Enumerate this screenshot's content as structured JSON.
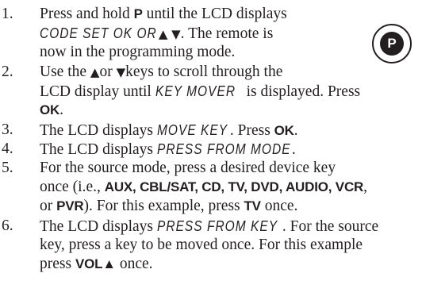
{
  "steps": [
    {
      "num": "1.",
      "l1": [
        "Press and hold ",
        "P",
        " until the LCD displays"
      ],
      "l2": [
        "CODE SET OK OR",
        "▲ ▼",
        ". The remote is"
      ],
      "l3": "now in the programming mode."
    },
    {
      "num": "2.",
      "l1": [
        "Use the ",
        "▲",
        "or ",
        "▼",
        "keys to scroll through the"
      ],
      "l2": [
        "LCD display until ",
        "KEY MOVER",
        " is displayed. Press"
      ],
      "l3": "OK",
      "l3_end": "."
    },
    {
      "num": "3.",
      "l1": [
        " The LCD displays ",
        "MOVE KEY",
        ". Press ",
        "OK",
        "."
      ]
    },
    {
      "num": "4.",
      "l1": [
        "The LCD displays ",
        "PRESS FROM MODE",
        "."
      ]
    },
    {
      "num": "5.",
      "l1": "For the source mode, press a desired device key",
      "l2": [
        "once (i.e., ",
        "AUX, CBL/SAT, CD, TV, DVD, AUDIO, VCR",
        ","
      ],
      "l3": [
        "or ",
        "PVR",
        "). For this example, press ",
        "TV",
        " once."
      ]
    },
    {
      "num": "6.",
      "l1": [
        "The LCD displays ",
        "PRESS FROM KEY",
        ". For the source"
      ],
      "l2": "key, press a key to be moved once. For this example",
      "l3": [
        "press ",
        "VOL▲",
        " once."
      ]
    }
  ],
  "p_icon": {
    "letter": "P"
  }
}
